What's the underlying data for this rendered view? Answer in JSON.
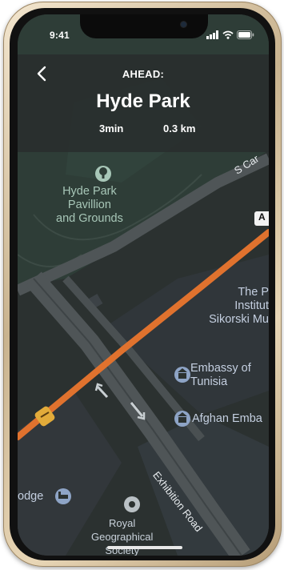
{
  "status_bar": {
    "time": "9:41"
  },
  "navigation": {
    "ahead_label": "AHEAD:",
    "destination": "Hyde Park",
    "time": "3min",
    "distance": "0.3 km"
  },
  "map": {
    "pois": [
      {
        "name": "Hyde Park Pavillion and Grounds",
        "lines": [
          "Hyde Park",
          "Pavillion",
          "and Grounds"
        ],
        "icon": "tree-icon"
      },
      {
        "name": "The Polish Institute Sikorski Museum",
        "lines": [
          "The P",
          "Institut",
          "Sikorski Mu"
        ]
      },
      {
        "name": "Embassy of Tunisia",
        "lines": [
          "Embassy of",
          "Tunisia"
        ],
        "icon": "building-icon"
      },
      {
        "name": "Afghan Embassy",
        "lines": [
          "Afghan Emba"
        ],
        "icon": "building-icon"
      },
      {
        "name": "Lodge",
        "lines": [
          "odge"
        ],
        "icon": "bed-icon"
      },
      {
        "name": "Royal Geographical Society",
        "lines": [
          "Royal",
          "Geographical",
          "Society"
        ],
        "icon": "circle-dot-icon"
      }
    ],
    "roads": [
      {
        "name": "S Carriage Drive",
        "label": "S Car"
      },
      {
        "name": "Exhibition Road",
        "label": "Exhibition Road"
      }
    ],
    "route_sign": "A",
    "colors": {
      "background": "#2a302f",
      "park": "#2e3f38",
      "route": "#e0722e",
      "road": "#5a5f61"
    }
  }
}
